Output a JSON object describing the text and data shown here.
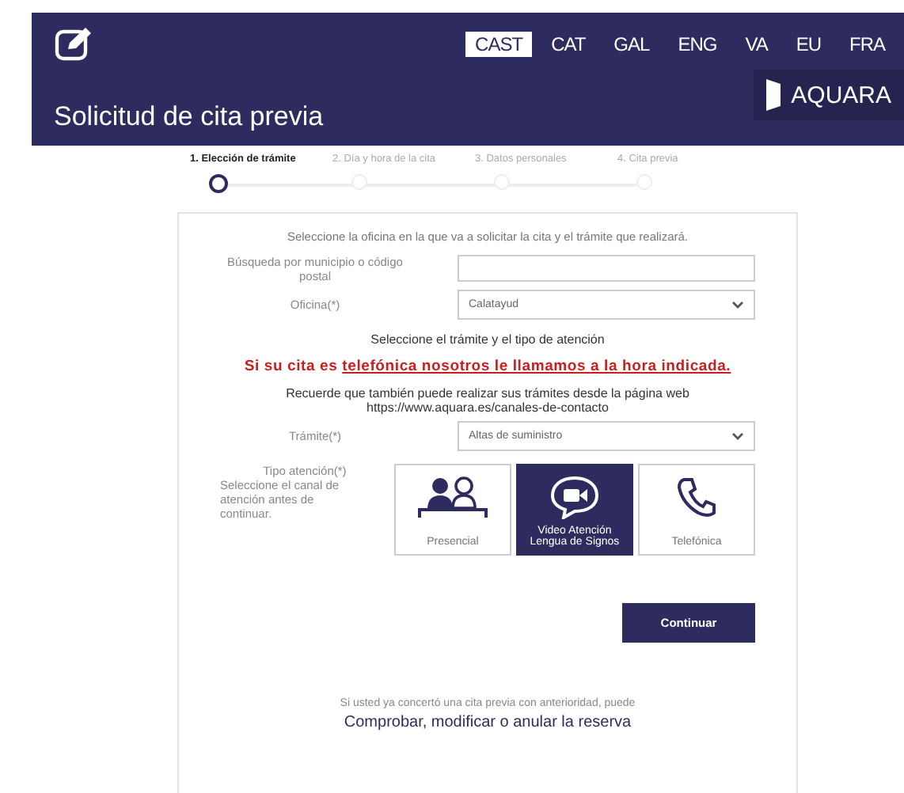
{
  "header": {
    "title": "Solicitud de cita previa",
    "languages": [
      {
        "label": "CAST",
        "selected": true
      },
      {
        "label": "CAT",
        "selected": false
      },
      {
        "label": "GAL",
        "selected": false
      },
      {
        "label": "ENG",
        "selected": false
      },
      {
        "label": "VA",
        "selected": false
      },
      {
        "label": "EU",
        "selected": false
      },
      {
        "label": "FRA",
        "selected": false
      }
    ],
    "brand": "AQUARA"
  },
  "steps": [
    {
      "label": "1. Elección de trámite",
      "selected": true
    },
    {
      "label": "2. Día y hora de la cita",
      "selected": false
    },
    {
      "label": "3. Datos personales",
      "selected": false
    },
    {
      "label": "4. Cita previa",
      "selected": false
    }
  ],
  "form": {
    "intro": "Seleccione la oficina en la que va a solicitar la cita y el trámite que realizará.",
    "search_label": "Búsqueda por municipio o código postal",
    "office_label": "Oficina(*)",
    "office_value": "Calatayud",
    "section_title": "Seleccione el trámite y el tipo de atención",
    "warning": {
      "lead": "Si su cita es ",
      "underlined": "telefónica nosotros le llamamos a la hora indicada."
    },
    "reminder": "Recuerde que también puede realizar sus trámites desde la página web https://www.aquara.es/canales-de-contacto",
    "procedure_label": "Trámite(*)",
    "procedure_value": "Altas de suministro",
    "attention_label": "Tipo atención(*)",
    "attention_hint": "Seleccione el canal de atención antes de continuar.",
    "attention_options": [
      {
        "kind": "people",
        "label": "Presencial",
        "selected": false
      },
      {
        "kind": "video",
        "label": "Video Atención Lengua de Signos",
        "selected": true
      },
      {
        "kind": "phone",
        "label": "Telefónica",
        "selected": false
      }
    ],
    "continue": "Continuar",
    "footer_note": "Si usted ya concertó una cita previa con anterioridad, puede",
    "footer_link": "Comprobar, modificar o anular la reserva"
  }
}
